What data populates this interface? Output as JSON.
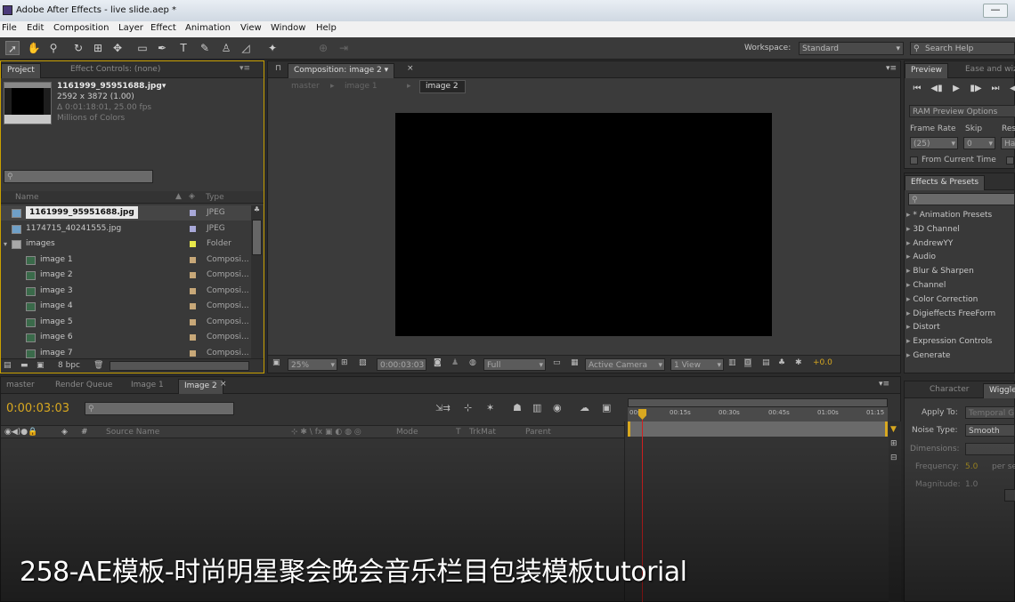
{
  "window": {
    "title": "Adobe After Effects - live slide.aep *",
    "minimize": "—"
  },
  "menu": [
    "File",
    "Edit",
    "Composition",
    "Layer",
    "Effect",
    "Animation",
    "View",
    "Window",
    "Help"
  ],
  "toolbar": {
    "workspace_label": "Workspace:",
    "workspace_value": "Standard",
    "search_placeholder": "Search Help"
  },
  "project": {
    "tabs": [
      "Project",
      "Effect Controls: (none)"
    ],
    "preview_name": "1161999_95951688.jpg▾",
    "preview_info": [
      "2592 x 3872 (1.00)",
      "Δ 0:01:18:01, 25.00 fps",
      "Millions of Colors"
    ],
    "col_name": "Name",
    "col_type": "Type",
    "items": [
      {
        "name": "1161999_95951688.jpg",
        "type": "JPEG",
        "label_color": "#a8a8d8",
        "icon": "image-file-icon",
        "indent": 0
      },
      {
        "name": "1174715_40241555.jpg",
        "type": "JPEG",
        "label_color": "#a8a8d8",
        "icon": "image-file-icon",
        "indent": 0
      },
      {
        "name": "images",
        "type": "Folder",
        "label_color": "#e8e84a",
        "icon": "folder-icon",
        "indent": 0
      },
      {
        "name": "image 1",
        "type": "Composi...",
        "label_color": "#c8a878",
        "icon": "composition-icon",
        "indent": 1
      },
      {
        "name": "image 2",
        "type": "Composi...",
        "label_color": "#c8a878",
        "icon": "composition-icon",
        "indent": 1
      },
      {
        "name": "image 3",
        "type": "Composi...",
        "label_color": "#c8a878",
        "icon": "composition-icon",
        "indent": 1
      },
      {
        "name": "image 4",
        "type": "Composi...",
        "label_color": "#c8a878",
        "icon": "composition-icon",
        "indent": 1
      },
      {
        "name": "image 5",
        "type": "Composi...",
        "label_color": "#c8a878",
        "icon": "composition-icon",
        "indent": 1
      },
      {
        "name": "image 6",
        "type": "Composi...",
        "label_color": "#c8a878",
        "icon": "composition-icon",
        "indent": 1
      },
      {
        "name": "image 7",
        "type": "Composi...",
        "label_color": "#c8a878",
        "icon": "composition-icon",
        "indent": 1
      }
    ],
    "bpc": "8 bpc"
  },
  "composition": {
    "tab": "Composition: image 2 ▾",
    "breadcrumbs": [
      "master",
      "image 1",
      "image 2"
    ],
    "zoom": "25%",
    "timecode": "0:00:03:03",
    "resolution": "Full",
    "camera": "Active Camera",
    "view": "1 View",
    "exposure": "+0.0"
  },
  "preview": {
    "tabs": [
      "Preview",
      "Ease and wiz"
    ],
    "ram_button": "RAM Preview Options",
    "frame_rate_label": "Frame Rate",
    "skip_label": "Skip",
    "res_label": "Res",
    "frame_rate_value": "(25)",
    "skip_value": "0",
    "res_value": "Ha",
    "from_current": "From Current Time"
  },
  "effects": {
    "tab": "Effects & Presets",
    "items": [
      "* Animation Presets",
      "3D Channel",
      "AndrewYY",
      "Audio",
      "Blur & Sharpen",
      "Channel",
      "Color Correction",
      "Digieffects FreeForm",
      "Distort",
      "Expression Controls",
      "Generate"
    ]
  },
  "timeline": {
    "tabs": [
      "master",
      "Render Queue",
      "Image 1",
      "Image 2"
    ],
    "timecode": "0:00:03:03",
    "col_source": "Source Name",
    "col_mode": "Mode",
    "col_t": "T",
    "col_trkmat": "TrkMat",
    "col_parent": "Parent",
    "ruler": [
      "00s",
      "00:15s",
      "00:30s",
      "00:45s",
      "01:00s",
      "01:15"
    ]
  },
  "wiggler": {
    "tabs": [
      "Character",
      "Wiggler"
    ],
    "apply_to_label": "Apply To:",
    "apply_to_value": "Temporal Graph",
    "noise_type_label": "Noise Type:",
    "noise_type_value": "Smooth",
    "dimensions_label": "Dimensions:",
    "frequency_label": "Frequency:",
    "frequency_value": "5.0",
    "frequency_unit": "per se",
    "magnitude_label": "Magnitude:",
    "magnitude_value": "1.0"
  },
  "subtitle": "258-AE模板-时尚明星聚会晚会音乐栏目包装模板tutorial",
  "colors": {
    "highlight": "#c8a000",
    "playhead": "#d02020",
    "timecode": "#d8a820"
  }
}
